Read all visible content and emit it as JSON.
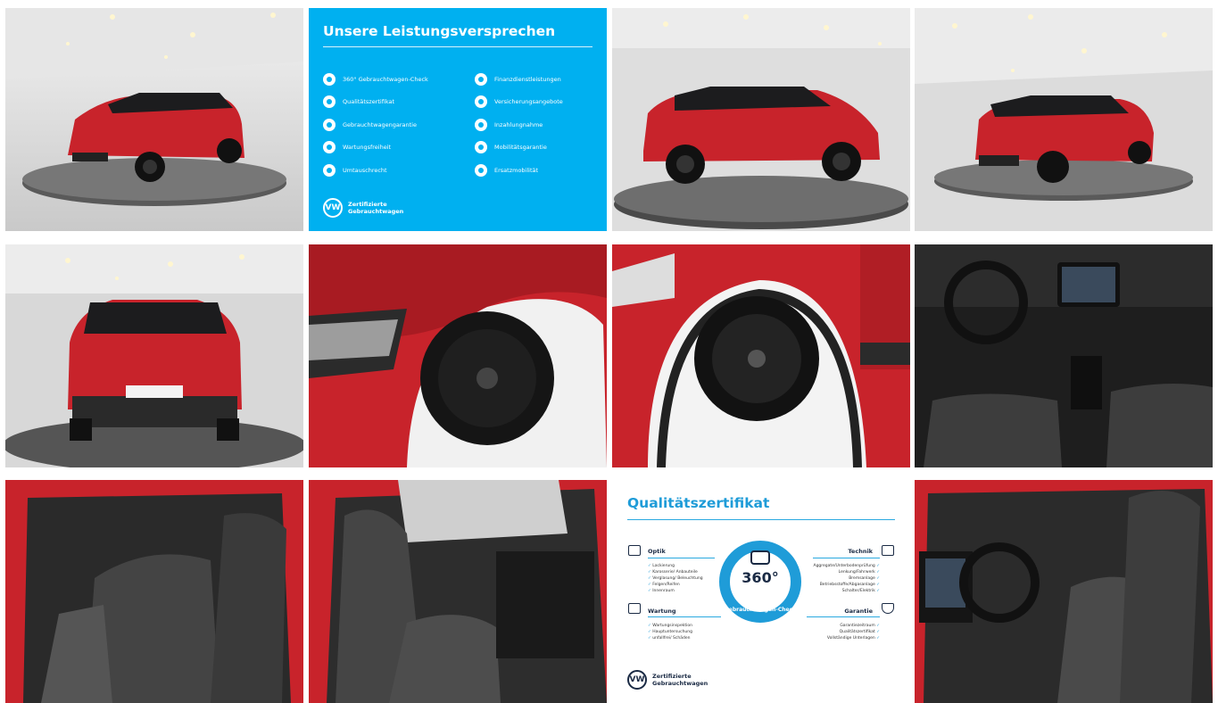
{
  "gallery": {
    "photos": [
      {
        "id": "front-left-turntable",
        "icon": "car-photo"
      },
      {
        "id": "side-right-turntable",
        "icon": "car-photo"
      },
      {
        "id": "rear-right-turntable",
        "icon": "car-photo"
      },
      {
        "id": "rear-turntable",
        "icon": "car-photo"
      },
      {
        "id": "front-fender-wheel",
        "icon": "car-photo"
      },
      {
        "id": "front-wheel-closeup",
        "icon": "car-photo"
      },
      {
        "id": "cockpit-interior",
        "icon": "car-photo"
      },
      {
        "id": "rear-seats",
        "icon": "car-photo"
      },
      {
        "id": "passenger-seat",
        "icon": "car-photo"
      },
      {
        "id": "driver-seat",
        "icon": "car-photo"
      }
    ]
  },
  "promises": {
    "title": "Unsere Leistungsversprechen",
    "left_items": [
      "360° Gebrauchtwagen-Check",
      "Qualitätszertifikat",
      "Gebrauchtwagengarantie",
      "Wartungsfreiheit",
      "Umtauschrecht"
    ],
    "right_items": [
      "Finanzdienstleistungen",
      "Versicherungsangebote",
      "Inzahlungnahme",
      "Mobilitätsgarantie",
      "Ersatzmobilität"
    ],
    "footer_line1": "Zertifizierte",
    "footer_line2": "Gebrauchtwagen",
    "bg_color": "#00b0f0"
  },
  "certificate": {
    "title": "Qualitätszertifikat",
    "badge_number": "360°",
    "badge_text": "Gebrauchtwagen-Check",
    "optik": {
      "title": "Optik",
      "items": [
        "Lackierung",
        "Karosserie/ Anbauteile",
        "Verglasung/ Beleuchtung",
        "Felgen/Reifen",
        "Innenraum"
      ]
    },
    "technik": {
      "title": "Technik",
      "items": [
        "Aggregate/Unterbodenprüfung",
        "Lenkung/Fahrwerk",
        "Bremsanlage",
        "Betriebsstoffe/Abgasanlage",
        "Schalter/Elektrik"
      ]
    },
    "wartung": {
      "title": "Wartung",
      "items": [
        "Wartungsinspektion",
        "Hauptuntersuchung",
        "unfallfrei/ Schäden"
      ]
    },
    "garantie": {
      "title": "Garantie",
      "items": [
        "Garantiezeitraum",
        "Qualitätszertifikat",
        "Vollständige Unterlagen"
      ]
    },
    "footer_line1": "Zertifizierte",
    "footer_line2": "Gebrauchtwagen",
    "accent_color": "#1f9cd8"
  },
  "colors": {
    "car_red": "#c8232b",
    "car_black": "#1c1c1e",
    "showroom": "#d9d9d9"
  }
}
